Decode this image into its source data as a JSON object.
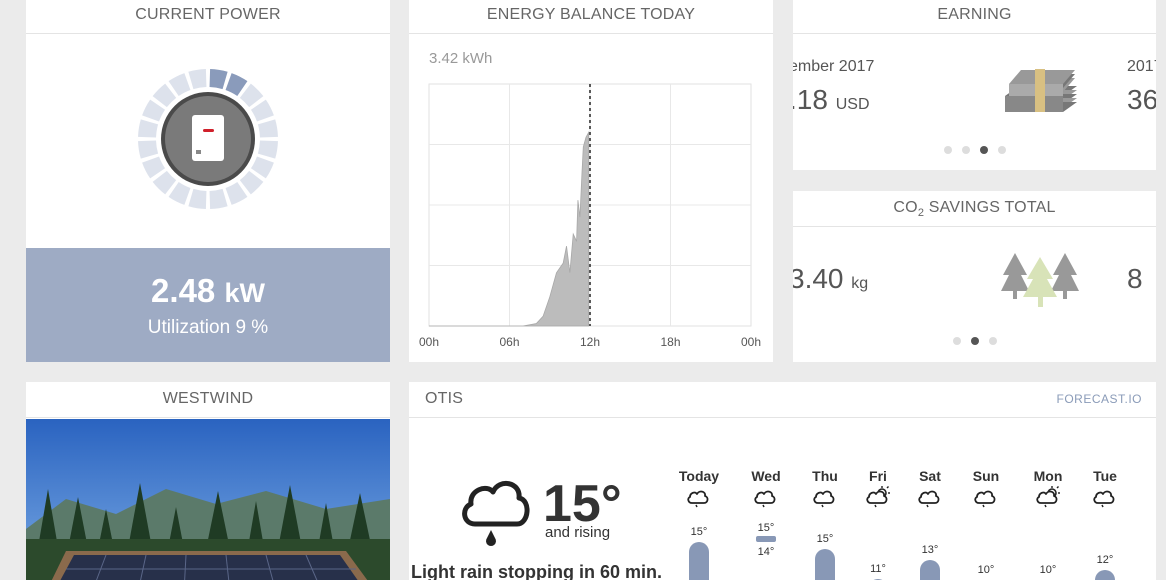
{
  "current_power": {
    "title": "CURRENT POWER",
    "value": "2.48",
    "unit": "kW",
    "utilization": "Utilization 9 %"
  },
  "energy_balance": {
    "title": "ENERGY BALANCE TODAY",
    "total": "3.42 kWh"
  },
  "chart_data": {
    "type": "area",
    "title": "",
    "xlabel": "",
    "ylabel": "",
    "x_ticks": [
      "00h",
      "06h",
      "12h",
      "18h",
      "00h"
    ],
    "x_hours": [
      0,
      1,
      2,
      3,
      4,
      5,
      6,
      7,
      7.5,
      8,
      8.5,
      9,
      9.5,
      10,
      10.25,
      10.5,
      10.75,
      11,
      11.1,
      11.25,
      11.4,
      11.5,
      11.7,
      11.9
    ],
    "values": [
      0,
      0,
      0,
      0,
      0,
      0,
      0,
      0,
      0.005,
      0.01,
      0.04,
      0.12,
      0.22,
      0.26,
      0.33,
      0.22,
      0.38,
      0.35,
      0.52,
      0.45,
      0.63,
      0.74,
      0.78,
      0.8
    ],
    "ylim": [
      0,
      1
    ],
    "xlim": [
      0,
      24
    ],
    "now_marker_hour": 12,
    "grid": true
  },
  "earning": {
    "title": "EARNING",
    "slides": [
      {
        "period": "ember 2017",
        "value": ".18",
        "unit": "USD"
      },
      {
        "period": "2017",
        "value": "36"
      }
    ],
    "icon": "money-stack-icon",
    "dots": 4,
    "active_dot": 2
  },
  "co2": {
    "title_prefix": "CO",
    "title_sub": "2",
    "title_suffix": " SAVINGS TOTAL",
    "slides": [
      {
        "value": "3.40",
        "unit": "kg"
      },
      {
        "value": "8"
      }
    ],
    "icon": "trees-icon",
    "dots": 3,
    "active_dot": 1
  },
  "westwind": {
    "title": "WESTWIND"
  },
  "weather": {
    "title": "OTIS",
    "provider": "FORECAST.IO",
    "now_temp": "15°",
    "trend": "and rising",
    "summary": "Light rain stopping in 60 min.",
    "days": [
      {
        "name": "Today",
        "icon": "cloud-icon",
        "hi": "15°",
        "lo": "",
        "bar": 1.0
      },
      {
        "name": "Wed",
        "icon": "cloud-icon",
        "hi": "15°",
        "lo": "14°",
        "bar": 0.15
      },
      {
        "name": "Thu",
        "icon": "cloud-icon",
        "hi": "15°",
        "lo": "",
        "bar": 0.85
      },
      {
        "name": "Fri",
        "icon": "sun-cloud-icon",
        "hi": "11°",
        "lo": "",
        "bar": 0.2
      },
      {
        "name": "Sat",
        "icon": "cloud-icon",
        "hi": "13°",
        "lo": "",
        "bar": 0.6
      },
      {
        "name": "Sun",
        "icon": "cloud-icon",
        "hi": "10°",
        "lo": "",
        "bar": 0
      },
      {
        "name": "Mon",
        "icon": "sun-cloud-icon",
        "hi": "10°",
        "lo": "",
        "bar": 0
      },
      {
        "name": "Tue",
        "icon": "cloud-icon",
        "hi": "12°",
        "lo": "",
        "bar": 0.4
      }
    ]
  }
}
